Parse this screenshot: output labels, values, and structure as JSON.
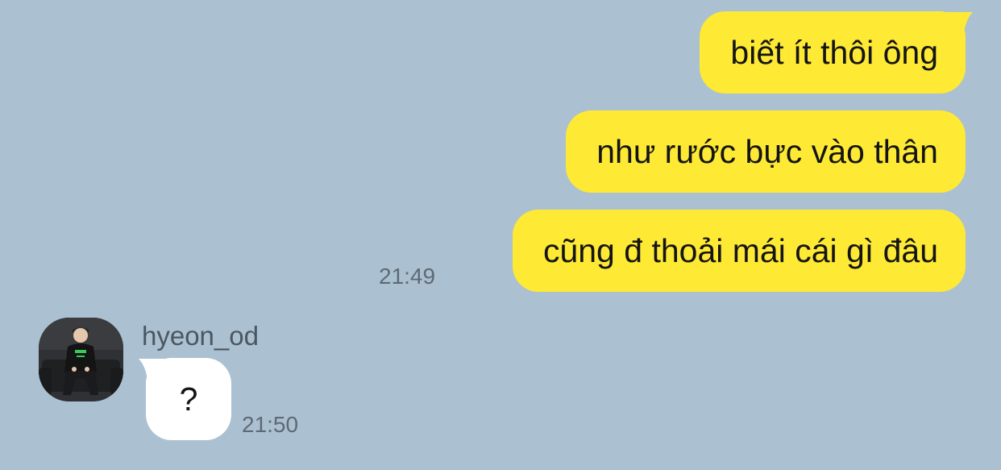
{
  "colors": {
    "background": "#abc1d1",
    "outgoing_bubble": "#fee934",
    "incoming_bubble": "#ffffff"
  },
  "outgoing": [
    {
      "text": "biết ít thôi ông"
    },
    {
      "text": "như rước bực vào thân"
    },
    {
      "text": "cũng đ thoải mái cái gì đâu"
    }
  ],
  "outgoing_time": "21:49",
  "incoming": {
    "sender": "hyeon_od",
    "text": "?",
    "time": "21:50",
    "avatar_icon": "profile-photo"
  }
}
